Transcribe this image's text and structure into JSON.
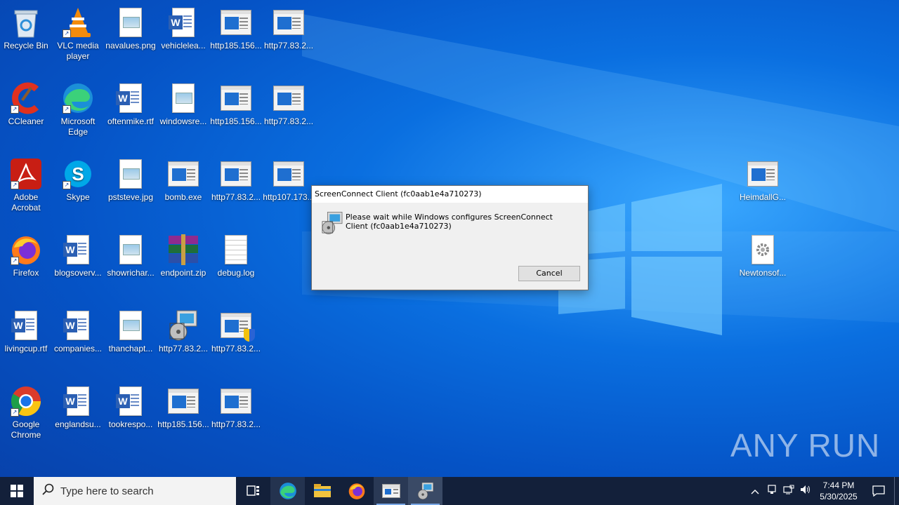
{
  "desktop_icons": [
    {
      "label": "Recycle Bin",
      "icon": "recycle-bin-icon"
    },
    {
      "label": "VLC media player",
      "icon": "vlc-icon"
    },
    {
      "label": "navalues.png",
      "icon": "image-file-icon"
    },
    {
      "label": "vehiclelea...",
      "icon": "word-doc-icon"
    },
    {
      "label": "http185.156...",
      "icon": "app-window-icon"
    },
    {
      "label": "http77.83.2...",
      "icon": "app-window-icon"
    },
    {
      "label": "CCleaner",
      "icon": "ccleaner-icon"
    },
    {
      "label": "Microsoft Edge",
      "icon": "edge-icon"
    },
    {
      "label": "oftenmike.rtf",
      "icon": "word-doc-icon"
    },
    {
      "label": "windowsre...",
      "icon": "image-file-icon"
    },
    {
      "label": "http185.156...",
      "icon": "app-window-icon"
    },
    {
      "label": "http77.83.2...",
      "icon": "app-window-icon"
    },
    {
      "label": "Adobe Acrobat",
      "icon": "acrobat-icon"
    },
    {
      "label": "Skype",
      "icon": "skype-icon"
    },
    {
      "label": "pststeve.jpg",
      "icon": "image-file-icon"
    },
    {
      "label": "bomb.exe",
      "icon": "app-window-icon"
    },
    {
      "label": "http77.83.2...",
      "icon": "app-window-icon"
    },
    {
      "label": "http107.173...",
      "icon": "app-window-icon"
    },
    {
      "label": "Firefox",
      "icon": "firefox-icon"
    },
    {
      "label": "blogsoverv...",
      "icon": "word-doc-icon"
    },
    {
      "label": "showrichar...",
      "icon": "image-file-icon"
    },
    {
      "label": "endpoint.zip",
      "icon": "winrar-icon"
    },
    {
      "label": "debug.log",
      "icon": "text-file-icon"
    },
    {
      "label": "livingcup.rtf",
      "icon": "word-doc-icon"
    },
    {
      "label": "companies...",
      "icon": "word-doc-icon"
    },
    {
      "label": "thanchapt...",
      "icon": "image-file-icon"
    },
    {
      "label": "http77.83.2...",
      "icon": "installer-icon"
    },
    {
      "label": "http77.83.2...",
      "icon": "app-shield-icon"
    },
    {
      "label": "Google Chrome",
      "icon": "chrome-icon"
    },
    {
      "label": "englandsu...",
      "icon": "word-doc-icon"
    },
    {
      "label": "tookrespo...",
      "icon": "word-doc-icon"
    },
    {
      "label": "http185.156...",
      "icon": "app-window-icon"
    },
    {
      "label": "http77.83.2...",
      "icon": "app-window-icon"
    },
    {
      "label": "HeimdallG...",
      "icon": "app-window-icon"
    },
    {
      "label": "Newtonsof...",
      "icon": "settings-file-icon"
    }
  ],
  "dialog": {
    "title": "ScreenConnect Client (fc0aab1e4a710273)",
    "message": "Please wait while Windows configures ScreenConnect Client (fc0aab1e4a710273)",
    "cancel_label": "Cancel"
  },
  "watermark": "ANY RUN",
  "taskbar": {
    "search_placeholder": "Type here to search",
    "time": "7:44 PM",
    "date": "5/30/2025",
    "apps": [
      "task-view-icon",
      "edge-icon",
      "file-explorer-icon",
      "firefox-icon",
      "app-window-icon",
      "installer-icon"
    ]
  }
}
